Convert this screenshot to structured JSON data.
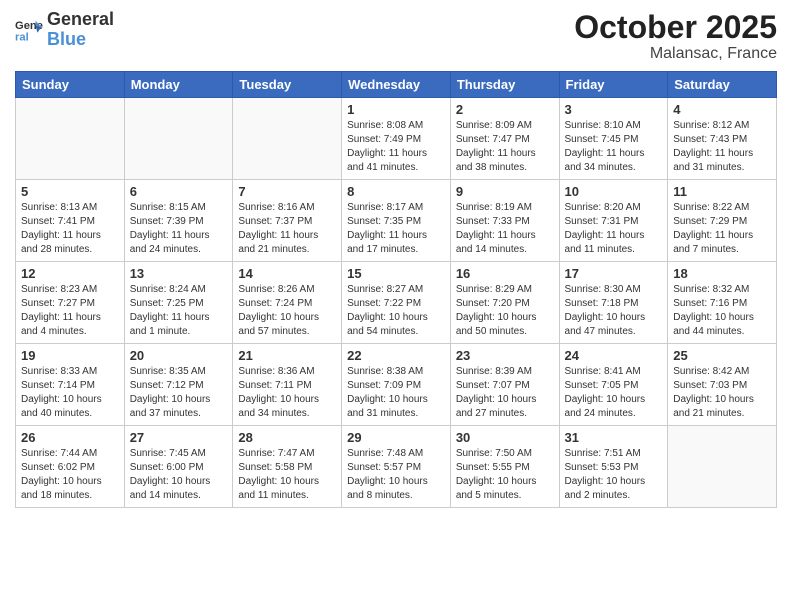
{
  "header": {
    "logo_line1": "General",
    "logo_line2": "Blue",
    "month": "October 2025",
    "location": "Malansac, France"
  },
  "weekdays": [
    "Sunday",
    "Monday",
    "Tuesday",
    "Wednesday",
    "Thursday",
    "Friday",
    "Saturday"
  ],
  "weeks": [
    [
      {
        "day": "",
        "info": ""
      },
      {
        "day": "",
        "info": ""
      },
      {
        "day": "",
        "info": ""
      },
      {
        "day": "1",
        "info": "Sunrise: 8:08 AM\nSunset: 7:49 PM\nDaylight: 11 hours\nand 41 minutes."
      },
      {
        "day": "2",
        "info": "Sunrise: 8:09 AM\nSunset: 7:47 PM\nDaylight: 11 hours\nand 38 minutes."
      },
      {
        "day": "3",
        "info": "Sunrise: 8:10 AM\nSunset: 7:45 PM\nDaylight: 11 hours\nand 34 minutes."
      },
      {
        "day": "4",
        "info": "Sunrise: 8:12 AM\nSunset: 7:43 PM\nDaylight: 11 hours\nand 31 minutes."
      }
    ],
    [
      {
        "day": "5",
        "info": "Sunrise: 8:13 AM\nSunset: 7:41 PM\nDaylight: 11 hours\nand 28 minutes."
      },
      {
        "day": "6",
        "info": "Sunrise: 8:15 AM\nSunset: 7:39 PM\nDaylight: 11 hours\nand 24 minutes."
      },
      {
        "day": "7",
        "info": "Sunrise: 8:16 AM\nSunset: 7:37 PM\nDaylight: 11 hours\nand 21 minutes."
      },
      {
        "day": "8",
        "info": "Sunrise: 8:17 AM\nSunset: 7:35 PM\nDaylight: 11 hours\nand 17 minutes."
      },
      {
        "day": "9",
        "info": "Sunrise: 8:19 AM\nSunset: 7:33 PM\nDaylight: 11 hours\nand 14 minutes."
      },
      {
        "day": "10",
        "info": "Sunrise: 8:20 AM\nSunset: 7:31 PM\nDaylight: 11 hours\nand 11 minutes."
      },
      {
        "day": "11",
        "info": "Sunrise: 8:22 AM\nSunset: 7:29 PM\nDaylight: 11 hours\nand 7 minutes."
      }
    ],
    [
      {
        "day": "12",
        "info": "Sunrise: 8:23 AM\nSunset: 7:27 PM\nDaylight: 11 hours\nand 4 minutes."
      },
      {
        "day": "13",
        "info": "Sunrise: 8:24 AM\nSunset: 7:25 PM\nDaylight: 11 hours\nand 1 minute."
      },
      {
        "day": "14",
        "info": "Sunrise: 8:26 AM\nSunset: 7:24 PM\nDaylight: 10 hours\nand 57 minutes."
      },
      {
        "day": "15",
        "info": "Sunrise: 8:27 AM\nSunset: 7:22 PM\nDaylight: 10 hours\nand 54 minutes."
      },
      {
        "day": "16",
        "info": "Sunrise: 8:29 AM\nSunset: 7:20 PM\nDaylight: 10 hours\nand 50 minutes."
      },
      {
        "day": "17",
        "info": "Sunrise: 8:30 AM\nSunset: 7:18 PM\nDaylight: 10 hours\nand 47 minutes."
      },
      {
        "day": "18",
        "info": "Sunrise: 8:32 AM\nSunset: 7:16 PM\nDaylight: 10 hours\nand 44 minutes."
      }
    ],
    [
      {
        "day": "19",
        "info": "Sunrise: 8:33 AM\nSunset: 7:14 PM\nDaylight: 10 hours\nand 40 minutes."
      },
      {
        "day": "20",
        "info": "Sunrise: 8:35 AM\nSunset: 7:12 PM\nDaylight: 10 hours\nand 37 minutes."
      },
      {
        "day": "21",
        "info": "Sunrise: 8:36 AM\nSunset: 7:11 PM\nDaylight: 10 hours\nand 34 minutes."
      },
      {
        "day": "22",
        "info": "Sunrise: 8:38 AM\nSunset: 7:09 PM\nDaylight: 10 hours\nand 31 minutes."
      },
      {
        "day": "23",
        "info": "Sunrise: 8:39 AM\nSunset: 7:07 PM\nDaylight: 10 hours\nand 27 minutes."
      },
      {
        "day": "24",
        "info": "Sunrise: 8:41 AM\nSunset: 7:05 PM\nDaylight: 10 hours\nand 24 minutes."
      },
      {
        "day": "25",
        "info": "Sunrise: 8:42 AM\nSunset: 7:03 PM\nDaylight: 10 hours\nand 21 minutes."
      }
    ],
    [
      {
        "day": "26",
        "info": "Sunrise: 7:44 AM\nSunset: 6:02 PM\nDaylight: 10 hours\nand 18 minutes."
      },
      {
        "day": "27",
        "info": "Sunrise: 7:45 AM\nSunset: 6:00 PM\nDaylight: 10 hours\nand 14 minutes."
      },
      {
        "day": "28",
        "info": "Sunrise: 7:47 AM\nSunset: 5:58 PM\nDaylight: 10 hours\nand 11 minutes."
      },
      {
        "day": "29",
        "info": "Sunrise: 7:48 AM\nSunset: 5:57 PM\nDaylight: 10 hours\nand 8 minutes."
      },
      {
        "day": "30",
        "info": "Sunrise: 7:50 AM\nSunset: 5:55 PM\nDaylight: 10 hours\nand 5 minutes."
      },
      {
        "day": "31",
        "info": "Sunrise: 7:51 AM\nSunset: 5:53 PM\nDaylight: 10 hours\nand 2 minutes."
      },
      {
        "day": "",
        "info": ""
      }
    ]
  ]
}
